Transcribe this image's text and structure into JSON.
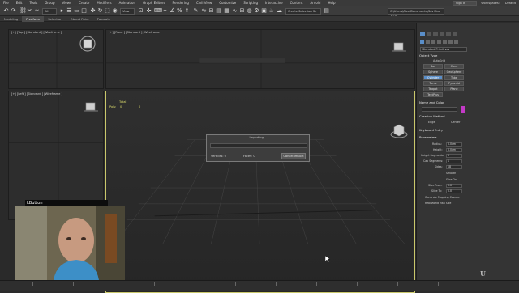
{
  "menubar": {
    "items": [
      "File",
      "Edit",
      "Tools",
      "Group",
      "Views",
      "Create",
      "Modifiers",
      "Animation",
      "Graph Editors",
      "Rendering",
      "Civil View",
      "Customize",
      "Scripting",
      "Interactive",
      "Content",
      "Arnold",
      "Help"
    ],
    "sign_in": "Sign In",
    "workspaces_label": "Workspaces:",
    "workspaces_value": "Default"
  },
  "toolbar": {
    "filter": "All",
    "view": "View",
    "selection_set": "Create Selection Se",
    "path": "C:\\Users\\Alex\\Documents\\3ds Max 2020"
  },
  "ribbon": {
    "tabs": [
      "Modeling",
      "Freeform",
      "Selection",
      "Object Paint",
      "Populate"
    ],
    "active": 1
  },
  "viewports": {
    "top": "[+] [Top ] [Standard ] [Wireframe ]",
    "front": "[+] [Front ] [Standard ] [Wireframe ]",
    "left": "[+] [Left ] [Standard ] [Wireframe ]",
    "perspective": "[+] [Perspective ] [Standard ] [Default Shading ]"
  },
  "stats": {
    "total_label": "Total",
    "polys_label": "Poly:",
    "polys_value": "0",
    "verts_value": "0"
  },
  "dialog": {
    "title": "Importing...",
    "vertices_label": "Vertices: 0",
    "faces_label": "Faces: 0",
    "cancel_label": "Cancel Import"
  },
  "command_panel": {
    "category": "Standard Primitives",
    "object_type_head": "Object Type",
    "autogrid": "AutoGrid",
    "buttons": [
      "Box",
      "Cone",
      "Sphere",
      "GeoSphere",
      "Cylinder",
      "Tube",
      "Torus",
      "Pyramid",
      "Teapot",
      "Plane",
      "TextPlus"
    ],
    "active_button": "Cylinder",
    "name_color_head": "Name and Color",
    "creation_head": "Creation Method",
    "creation_edge": "Edge",
    "creation_center": "Center",
    "keyboard_head": "Keyboard Entry",
    "params_head": "Parameters",
    "params": [
      {
        "label": "Radius:",
        "value": "0.0cm"
      },
      {
        "label": "Height:",
        "value": "0.0cm"
      },
      {
        "label": "Height Segments:",
        "value": "5"
      },
      {
        "label": "Cap Segments:",
        "value": "1"
      },
      {
        "label": "Sides:",
        "value": "18"
      }
    ],
    "smooth": "Smooth",
    "slice_on": "Slice On",
    "slice_from": "Slice From:",
    "slice_to": "Slice To:",
    "slice_from_value": "0.0",
    "slice_to_value": "0.0",
    "gen_mapping": "Generate Mapping Coords.",
    "real_world": "Real-World Map Size"
  },
  "overlay": {
    "lbutton": "LButton"
  },
  "colors": {
    "accent": "#5a8ec8",
    "viewport_border": "#c9c76b",
    "stats_text": "#d8d86a",
    "swatch": "#c43ac7"
  }
}
